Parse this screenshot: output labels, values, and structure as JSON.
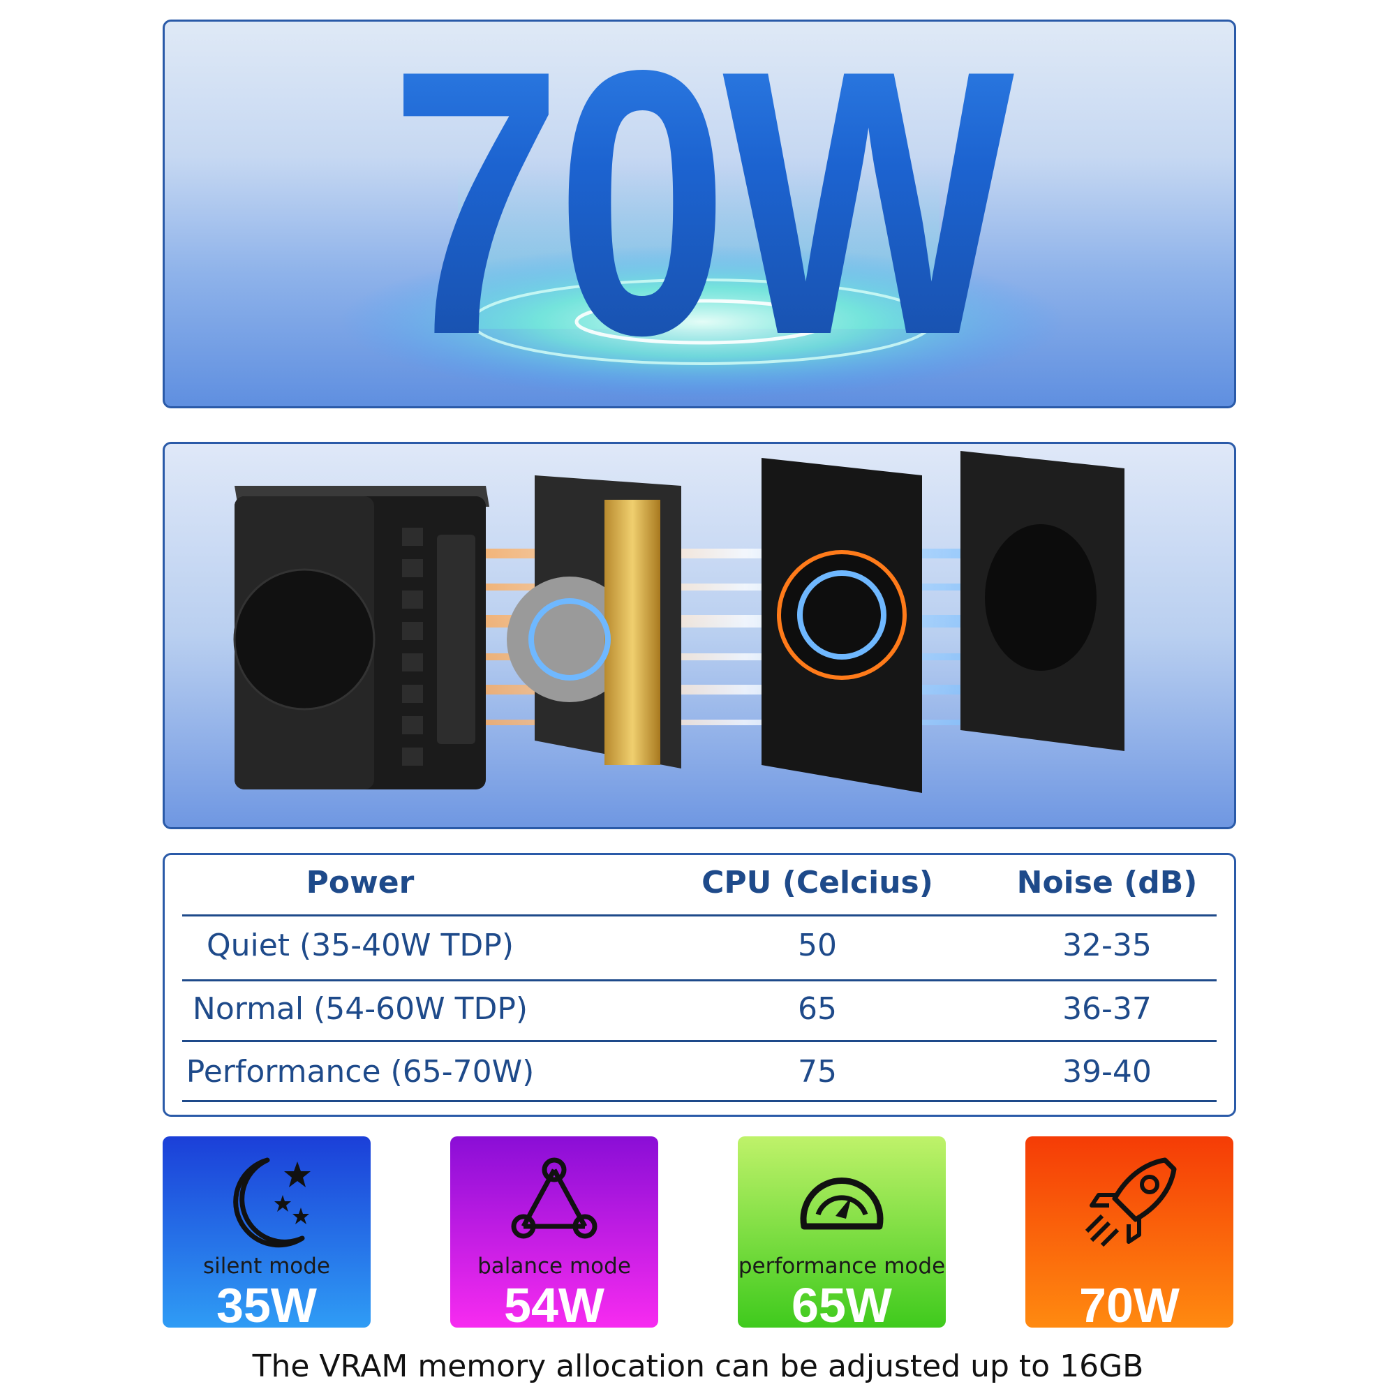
{
  "hero": {
    "title": "70W"
  },
  "table": {
    "headers": [
      "Power",
      "CPU (Celcius)",
      "Noise (dB)"
    ],
    "rows": [
      [
        "Quiet (35-40W TDP)",
        "50",
        "32-35"
      ],
      [
        "Normal (54-60W TDP)",
        "65",
        "36-37"
      ],
      [
        "Performance (65-70W)",
        "75",
        "39-40"
      ]
    ]
  },
  "modes": [
    {
      "label": "silent mode",
      "watts": "35W",
      "icon": "moon-stars-icon",
      "colors": [
        "#1b3fd8",
        "#2f9cf5"
      ]
    },
    {
      "label": "balance mode",
      "watts": "54W",
      "icon": "triangle-nodes-icon",
      "colors": [
        "#8a0ed6",
        "#f72bf0"
      ]
    },
    {
      "label": "performance mode",
      "watts": "65W",
      "icon": "gauge-icon",
      "colors": [
        "#bff26a",
        "#3fca1d"
      ]
    },
    {
      "label": "",
      "watts": "70W",
      "icon": "rocket-icon",
      "colors": [
        "#f53c06",
        "#ff8a10"
      ]
    }
  ],
  "caption": "The VRAM memory allocation can be adjusted up to 16GB"
}
